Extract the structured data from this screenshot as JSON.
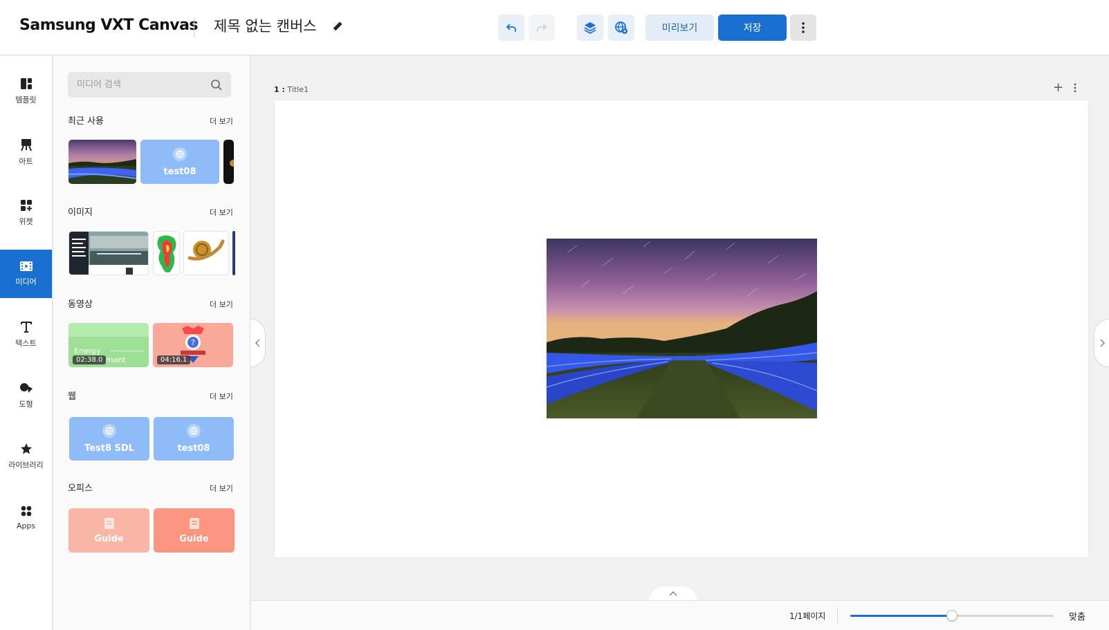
{
  "header": {
    "brand": "Samsung VXT Canvas",
    "doc_title": "제목 없는 캔버스",
    "preview_label": "미리보기",
    "save_label": "저장"
  },
  "rail": {
    "items": [
      {
        "label": "템플릿",
        "icon": "template-icon"
      },
      {
        "label": "아트",
        "icon": "easel-icon"
      },
      {
        "label": "위젯",
        "icon": "widget-icon"
      },
      {
        "label": "미디어",
        "icon": "media-icon",
        "active": true
      },
      {
        "label": "텍스트",
        "icon": "text-icon"
      },
      {
        "label": "도형",
        "icon": "shapes-icon"
      },
      {
        "label": "라이브러리",
        "icon": "star-icon"
      },
      {
        "label": "Apps",
        "icon": "apps-icon"
      }
    ]
  },
  "panel": {
    "search_placeholder": "미디어 검색",
    "more_label": "더 보기",
    "recent": {
      "title": "최근 사용",
      "web_tile": "test08"
    },
    "images": {
      "title": "이미지"
    },
    "videos": {
      "title": "동영상",
      "items": [
        {
          "title": "Energy",
          "title_suffix": "ment",
          "duration": "02:38.0"
        },
        {
          "duration": "04:16.1"
        }
      ]
    },
    "web": {
      "title": "웹",
      "items": [
        "Test8 SDL",
        "test08"
      ]
    },
    "office": {
      "title": "오피스",
      "items": [
        "Guide",
        "Guide"
      ]
    }
  },
  "canvas": {
    "page_number": "1 :",
    "page_name": "Title1"
  },
  "footer": {
    "page_count": "1/1페이지",
    "zoom_fraction": 0.5,
    "fit_label": "맞춤"
  },
  "colors": {
    "accent": "#1a70d1",
    "web_tile": "#8fbcf7",
    "office_tile_light": "#f9b6a6",
    "office_tile": "#fa9580"
  }
}
